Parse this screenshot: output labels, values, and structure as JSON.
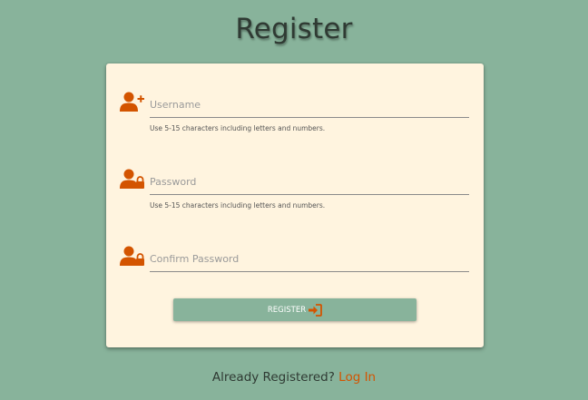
{
  "page": {
    "title": "Register"
  },
  "form": {
    "username": {
      "placeholder": "Username",
      "value": "",
      "hint": "Use 5-15 characters including letters and numbers.",
      "icon": "user-plus-icon"
    },
    "password": {
      "placeholder": "Password",
      "value": "",
      "hint": "Use 5-15 characters including letters and numbers.",
      "icon": "user-lock-icon"
    },
    "confirm_password": {
      "placeholder": "Confirm Password",
      "value": "",
      "icon": "user-lock-icon"
    },
    "submit": {
      "label": "REGISTER",
      "icon": "sign-in-icon"
    }
  },
  "footer": {
    "prompt": "Already Registered?",
    "link_label": "Log In"
  },
  "colors": {
    "background": "#88b39b",
    "card": "#fff4df",
    "accent": "#d35400",
    "button": "#88b39b"
  }
}
